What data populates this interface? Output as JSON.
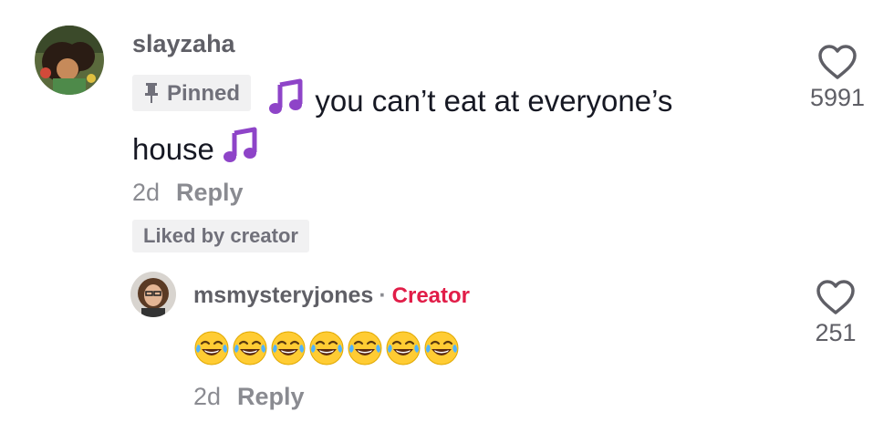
{
  "comment": {
    "username": "slayzaha",
    "pinned_label": "Pinned",
    "text_line1": "you can’t eat at everyone’s",
    "text_line2": "house",
    "time": "2d",
    "reply_label": "Reply",
    "liked_by_creator": "Liked by creator",
    "like_count": "5991",
    "icons": {
      "pin": "pin-icon",
      "note": "musical-notes-icon",
      "heart": "heart-outline-icon"
    }
  },
  "reply": {
    "username": "msmysteryjones",
    "separator": "·",
    "creator_label": "Creator",
    "emoji_name": "face-with-tears-of-joy",
    "emoji_count": 7,
    "time": "2d",
    "reply_label": "Reply",
    "like_count": "251"
  },
  "colors": {
    "creator_accent": "#e11d48",
    "note_purple": "#8e44c8",
    "muted_text": "#8a8b91",
    "badge_bg": "#f1f1f2"
  }
}
